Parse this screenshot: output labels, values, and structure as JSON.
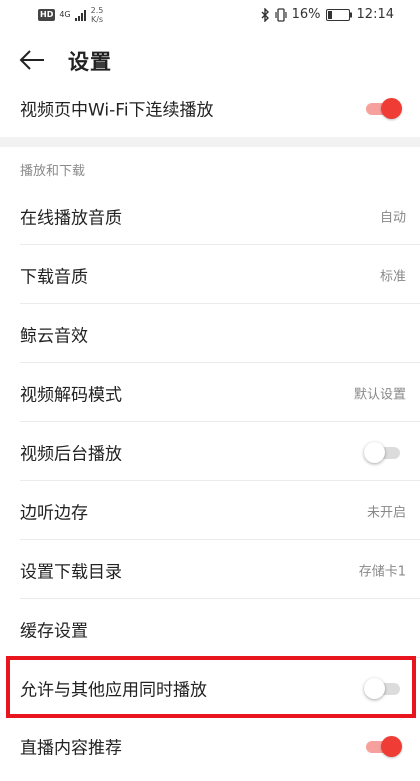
{
  "status_bar": {
    "hd": "HD",
    "network": "4G",
    "speed_value": "2.5",
    "speed_unit": "K/s",
    "battery_percent": "16%",
    "time": "12:14"
  },
  "header": {
    "title": "设置"
  },
  "top_row": {
    "label": "视频页中Wi-Fi下连续播放",
    "enabled": true
  },
  "section": {
    "title": "播放和下载"
  },
  "rows": [
    {
      "label": "在线播放音质",
      "value": "自动"
    },
    {
      "label": "下载音质",
      "value": "标准"
    },
    {
      "label": "鲸云音效",
      "value": ""
    },
    {
      "label": "视频解码模式",
      "value": "默认设置"
    },
    {
      "label": "视频后台播放",
      "toggle": false
    },
    {
      "label": "边听边存",
      "value": "未开启"
    },
    {
      "label": "设置下载目录",
      "value": "存储卡1"
    },
    {
      "label": "缓存设置",
      "value": ""
    },
    {
      "label": "允许与其他应用同时播放",
      "toggle": false
    },
    {
      "label": "直播内容推荐",
      "toggle": true
    }
  ],
  "colors": {
    "accent": "#ef3c34",
    "highlight_border": "#e8141e"
  }
}
